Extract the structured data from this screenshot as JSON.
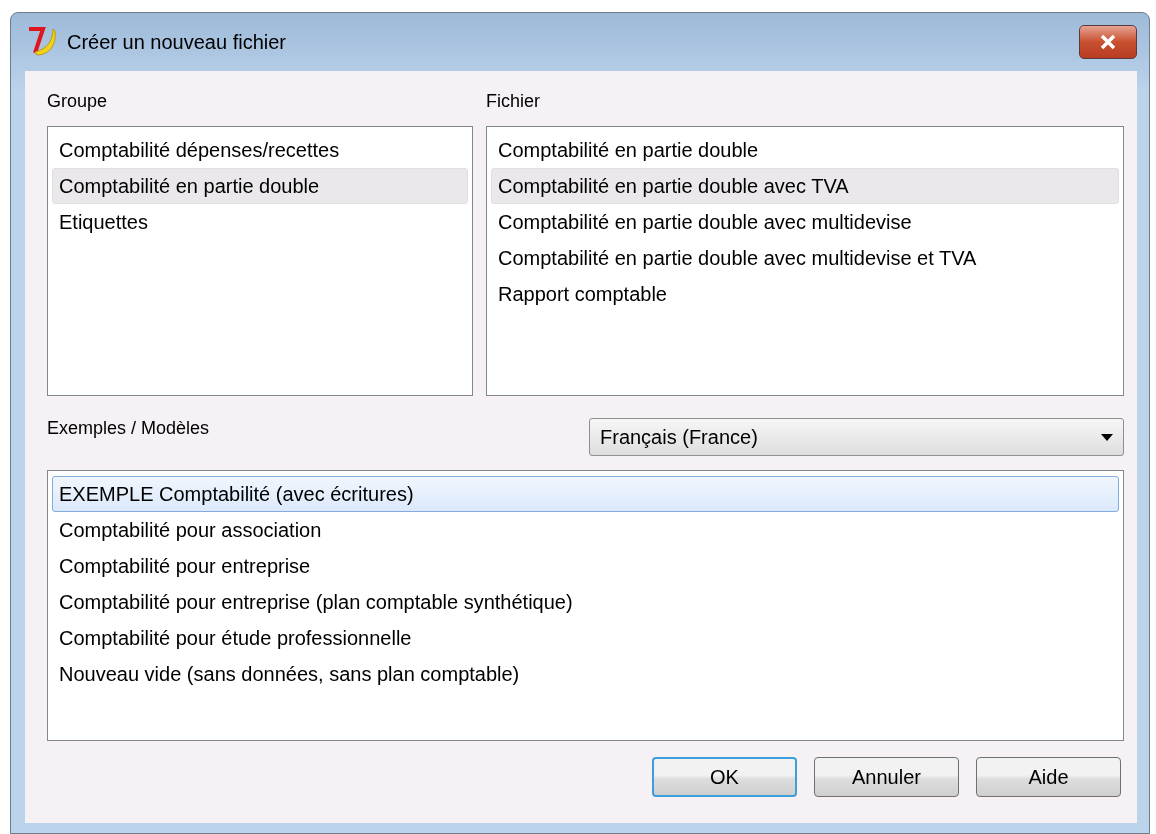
{
  "window": {
    "title": "Créer un nouveau fichier"
  },
  "groups": {
    "label": "Groupe",
    "items": [
      {
        "label": "Comptabilité dépenses/recettes",
        "selected": false
      },
      {
        "label": "Comptabilité en partie double",
        "selected": true
      },
      {
        "label": "Etiquettes",
        "selected": false
      }
    ]
  },
  "files": {
    "label": "Fichier",
    "items": [
      {
        "label": "Comptabilité en partie double",
        "selected": false
      },
      {
        "label": "Comptabilité en partie double avec TVA",
        "selected": true
      },
      {
        "label": "Comptabilité en partie double avec multidevise",
        "selected": false
      },
      {
        "label": "Comptabilité en partie double avec multidevise et TVA",
        "selected": false
      },
      {
        "label": "Rapport comptable",
        "selected": false
      }
    ]
  },
  "examples": {
    "label": "Exemples / Modèles",
    "language": "Français (France)",
    "items": [
      {
        "label": "EXEMPLE Comptabilité (avec écritures)",
        "selected": true
      },
      {
        "label": "Comptabilité pour association",
        "selected": false
      },
      {
        "label": "Comptabilité pour entreprise",
        "selected": false
      },
      {
        "label": "Comptabilité pour entreprise (plan comptable synthétique)",
        "selected": false
      },
      {
        "label": "Comptabilité pour étude professionnelle",
        "selected": false
      },
      {
        "label": "Nouveau vide (sans données, sans plan comptable)",
        "selected": false
      }
    ]
  },
  "buttons": [
    {
      "label": "OK",
      "default": true
    },
    {
      "label": "Annuler",
      "default": false
    },
    {
      "label": "Aide",
      "default": false
    }
  ]
}
